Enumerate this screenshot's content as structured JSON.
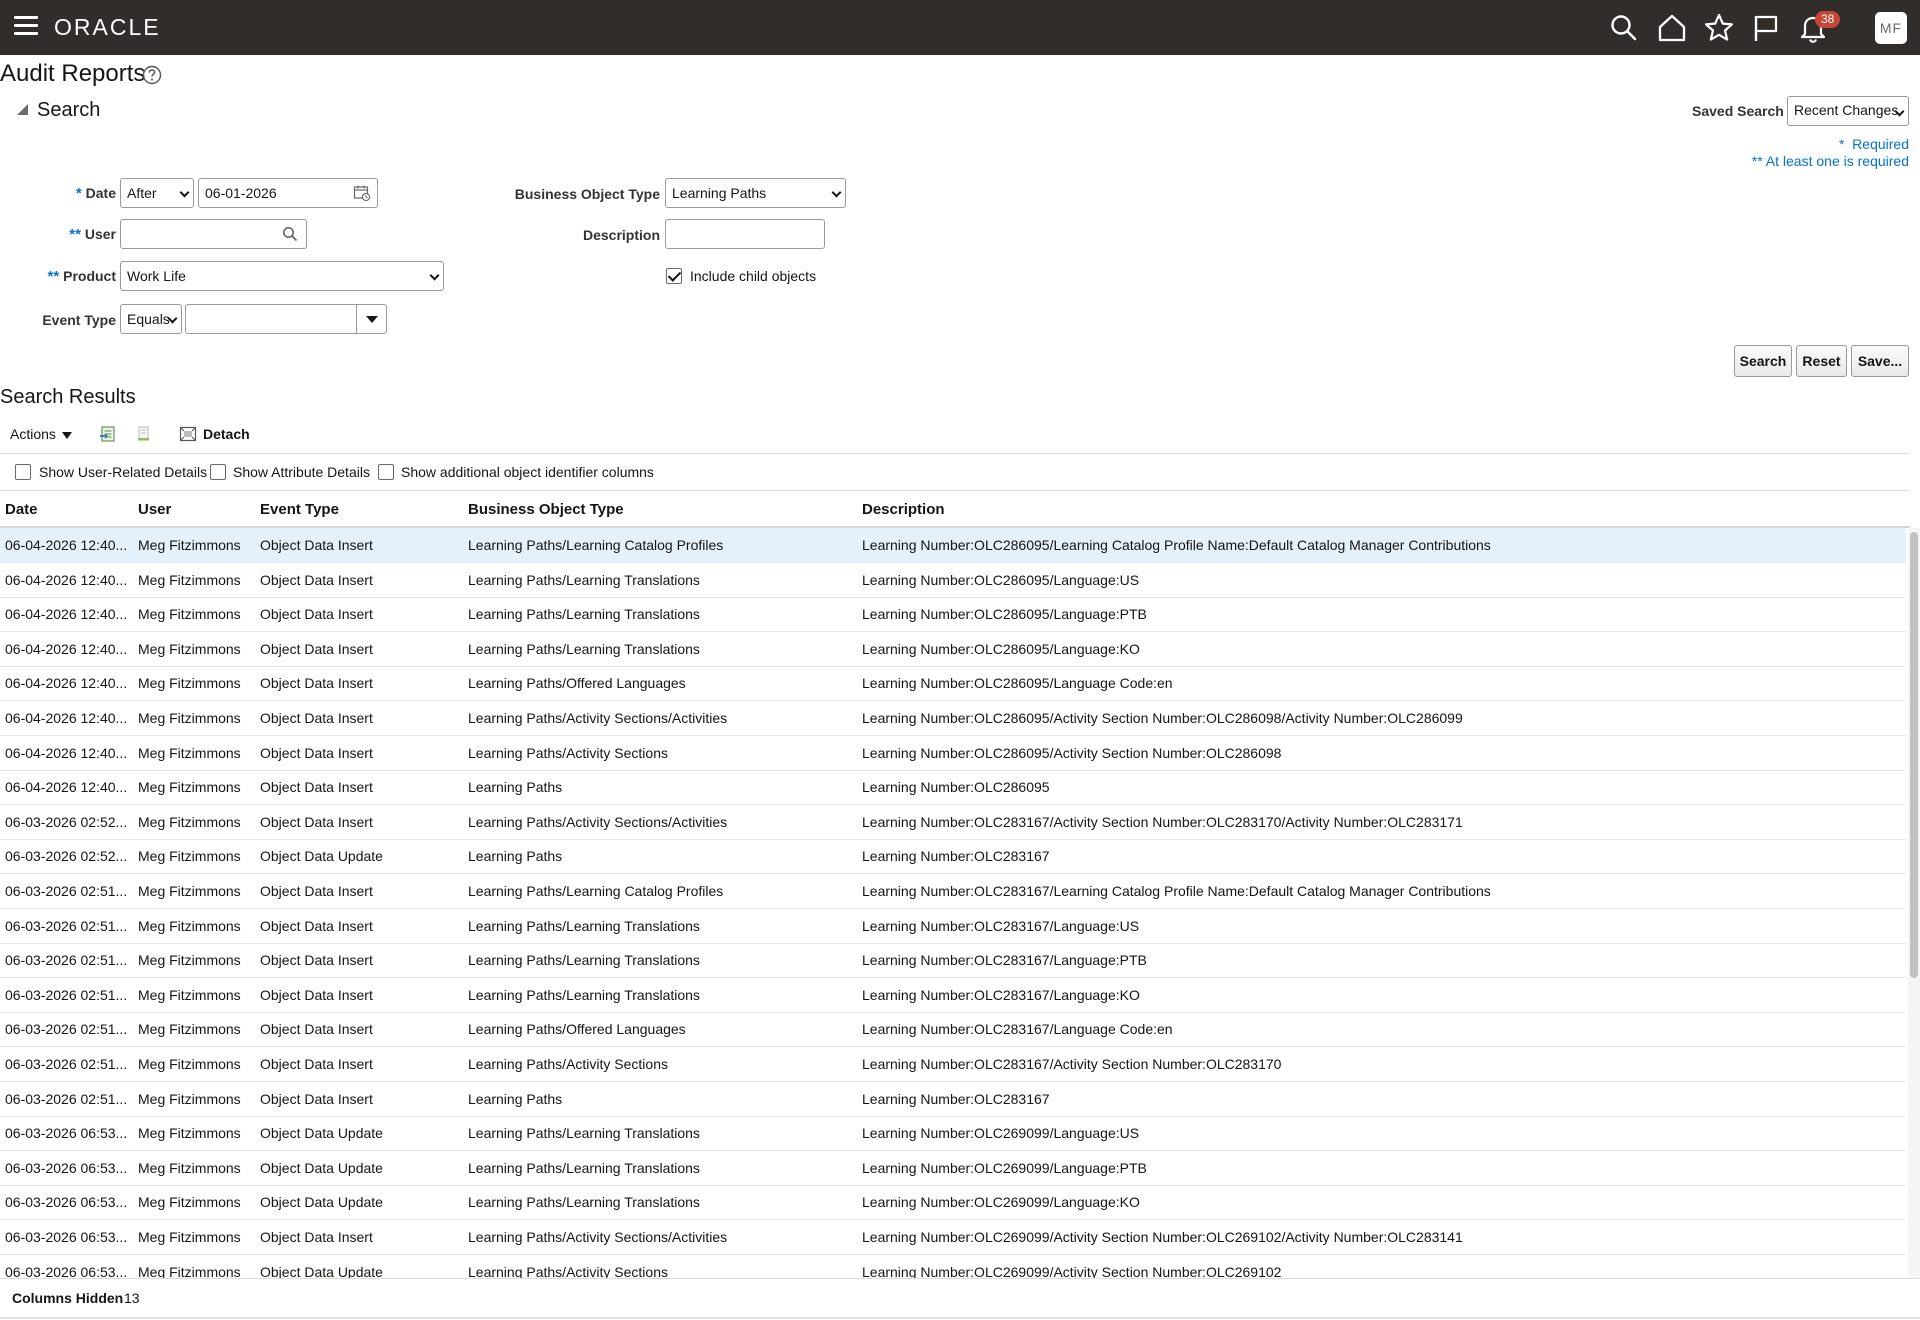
{
  "header": {
    "logo": "ORACLE",
    "notifications_count": "38",
    "avatar_initials": "MF"
  },
  "page": {
    "title": "Audit Reports"
  },
  "search": {
    "header": "Search",
    "saved_search_label": "Saved Search",
    "saved_search_value": "Recent Changes",
    "required_note": "Required",
    "at_least_one_note": "** At least one is required",
    "date_label": "Date",
    "date_operator": "After",
    "date_value": "06-01-2026",
    "user_label": "User",
    "user_value": "",
    "product_label": "Product",
    "product_value": "Work Life",
    "event_type_label": "Event Type",
    "event_type_operator": "Equals",
    "event_type_value": "",
    "business_object_type_label": "Business Object Type",
    "business_object_type_value": "Learning Paths",
    "description_label": "Description",
    "description_value": "",
    "include_child_label": "Include child objects",
    "include_child_checked": true,
    "buttons": {
      "search": "Search",
      "reset": "Reset",
      "save": "Save..."
    }
  },
  "results": {
    "title": "Search Results",
    "actions_label": "Actions",
    "detach_label": "Detach",
    "options": {
      "user_related": "Show User-Related Details",
      "attribute": "Show Attribute Details",
      "object_identifier": "Show additional object identifier columns"
    },
    "columns": [
      "Date",
      "User",
      "Event Type",
      "Business Object Type",
      "Description"
    ],
    "rows": [
      [
        "06-04-2026 12:40...",
        "Meg Fitzimmons",
        "Object Data Insert",
        "Learning Paths/Learning Catalog Profiles",
        "Learning Number:OLC286095/Learning Catalog Profile Name:Default Catalog Manager Contributions"
      ],
      [
        "06-04-2026 12:40...",
        "Meg Fitzimmons",
        "Object Data Insert",
        "Learning Paths/Learning Translations",
        "Learning Number:OLC286095/Language:US"
      ],
      [
        "06-04-2026 12:40...",
        "Meg Fitzimmons",
        "Object Data Insert",
        "Learning Paths/Learning Translations",
        "Learning Number:OLC286095/Language:PTB"
      ],
      [
        "06-04-2026 12:40...",
        "Meg Fitzimmons",
        "Object Data Insert",
        "Learning Paths/Learning Translations",
        "Learning Number:OLC286095/Language:KO"
      ],
      [
        "06-04-2026 12:40...",
        "Meg Fitzimmons",
        "Object Data Insert",
        "Learning Paths/Offered Languages",
        "Learning Number:OLC286095/Language Code:en"
      ],
      [
        "06-04-2026 12:40...",
        "Meg Fitzimmons",
        "Object Data Insert",
        "Learning Paths/Activity Sections/Activities",
        "Learning Number:OLC286095/Activity Section Number:OLC286098/Activity Number:OLC286099"
      ],
      [
        "06-04-2026 12:40...",
        "Meg Fitzimmons",
        "Object Data Insert",
        "Learning Paths/Activity Sections",
        "Learning Number:OLC286095/Activity Section Number:OLC286098"
      ],
      [
        "06-04-2026 12:40...",
        "Meg Fitzimmons",
        "Object Data Insert",
        "Learning Paths",
        "Learning Number:OLC286095"
      ],
      [
        "06-03-2026 02:52...",
        "Meg Fitzimmons",
        "Object Data Insert",
        "Learning Paths/Activity Sections/Activities",
        "Learning Number:OLC283167/Activity Section Number:OLC283170/Activity Number:OLC283171"
      ],
      [
        "06-03-2026 02:52...",
        "Meg Fitzimmons",
        "Object Data Update",
        "Learning Paths",
        "Learning Number:OLC283167"
      ],
      [
        "06-03-2026 02:51...",
        "Meg Fitzimmons",
        "Object Data Insert",
        "Learning Paths/Learning Catalog Profiles",
        "Learning Number:OLC283167/Learning Catalog Profile Name:Default Catalog Manager Contributions"
      ],
      [
        "06-03-2026 02:51...",
        "Meg Fitzimmons",
        "Object Data Insert",
        "Learning Paths/Learning Translations",
        "Learning Number:OLC283167/Language:US"
      ],
      [
        "06-03-2026 02:51...",
        "Meg Fitzimmons",
        "Object Data Insert",
        "Learning Paths/Learning Translations",
        "Learning Number:OLC283167/Language:PTB"
      ],
      [
        "06-03-2026 02:51...",
        "Meg Fitzimmons",
        "Object Data Insert",
        "Learning Paths/Learning Translations",
        "Learning Number:OLC283167/Language:KO"
      ],
      [
        "06-03-2026 02:51...",
        "Meg Fitzimmons",
        "Object Data Insert",
        "Learning Paths/Offered Languages",
        "Learning Number:OLC283167/Language Code:en"
      ],
      [
        "06-03-2026 02:51...",
        "Meg Fitzimmons",
        "Object Data Insert",
        "Learning Paths/Activity Sections",
        "Learning Number:OLC283167/Activity Section Number:OLC283170"
      ],
      [
        "06-03-2026 02:51...",
        "Meg Fitzimmons",
        "Object Data Insert",
        "Learning Paths",
        "Learning Number:OLC283167"
      ],
      [
        "06-03-2026 06:53...",
        "Meg Fitzimmons",
        "Object Data Update",
        "Learning Paths/Learning Translations",
        "Learning Number:OLC269099/Language:US"
      ],
      [
        "06-03-2026 06:53...",
        "Meg Fitzimmons",
        "Object Data Update",
        "Learning Paths/Learning Translations",
        "Learning Number:OLC269099/Language:PTB"
      ],
      [
        "06-03-2026 06:53...",
        "Meg Fitzimmons",
        "Object Data Update",
        "Learning Paths/Learning Translations",
        "Learning Number:OLC269099/Language:KO"
      ],
      [
        "06-03-2026 06:53...",
        "Meg Fitzimmons",
        "Object Data Insert",
        "Learning Paths/Activity Sections/Activities",
        "Learning Number:OLC269099/Activity Section Number:OLC269102/Activity Number:OLC283141"
      ],
      [
        "06-03-2026 06:53...",
        "Meg Fitzimmons",
        "Object Data Update",
        "Learning Paths/Activity Sections",
        "Learning Number:OLC269099/Activity Section Number:OLC269102"
      ]
    ],
    "footer": {
      "columns_hidden_label": "Columns Hidden",
      "columns_hidden_value": "13"
    }
  },
  "colors": {
    "topbar": "#312d2a",
    "badge": "#c74634",
    "required": "#0572ce",
    "selected_row": "#e4f0fa"
  },
  "icons": [
    "hamburger-icon",
    "search-icon",
    "home-icon",
    "favorites-star-icon",
    "flag-icon",
    "notifications-bell-icon",
    "help-icon",
    "calendar-icon",
    "magnifier-icon",
    "export-icon",
    "freeze-icon",
    "detach-icon"
  ]
}
